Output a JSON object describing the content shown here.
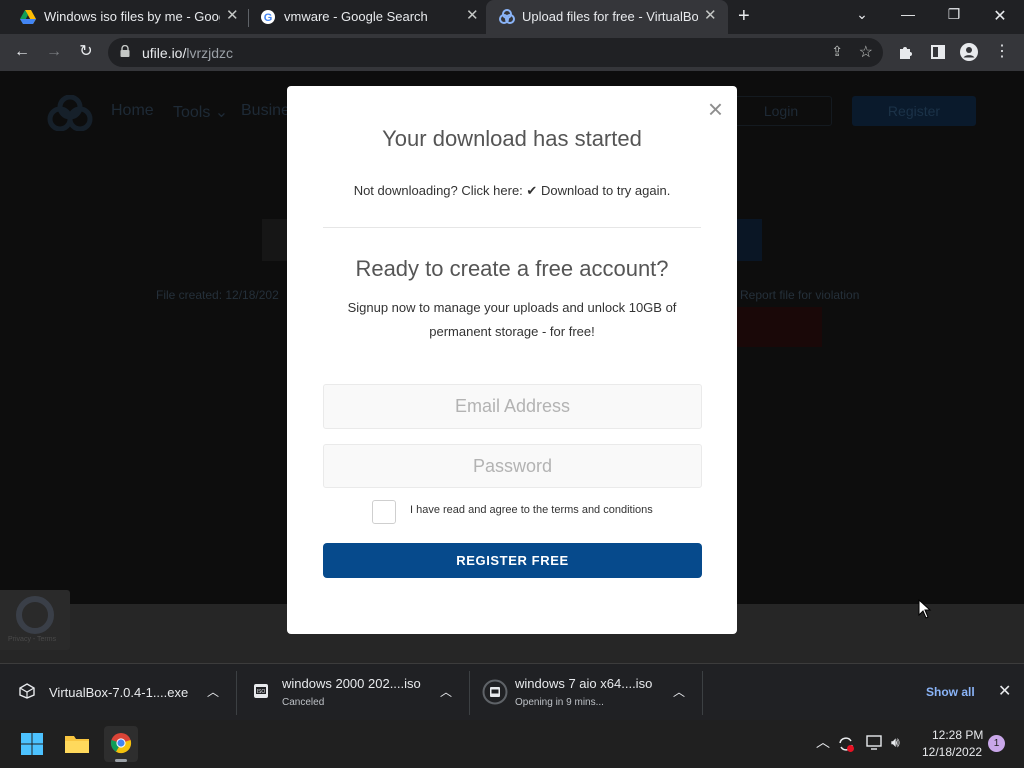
{
  "browser": {
    "tabs": [
      {
        "title": "Windows iso files by me - Google",
        "favicon": "google-drive-icon",
        "active": false
      },
      {
        "title": "vmware - Google Search",
        "favicon": "google-icon",
        "active": false
      },
      {
        "title": "Upload files for free - VirtualBox-",
        "favicon": "ufile-icon",
        "active": true
      }
    ],
    "url_host": "ufile.io/",
    "url_path": "lvrzjdzc"
  },
  "site": {
    "nav": [
      "Home",
      "Tools ⌄",
      "Busine"
    ],
    "login_label": "Login",
    "register_label": "Register",
    "file_created": "File created: 12/18/202",
    "report_link": "Report file for violation"
  },
  "modal": {
    "title": "Your download has started",
    "retry_prefix": "Not downloading? Click here:",
    "retry_link": "Download to try again.",
    "subtitle": "Ready to create a free account?",
    "description": "Signup now to manage your uploads and unlock 10GB of permanent storage - for free!",
    "email_placeholder": "Email Address",
    "password_placeholder": "Password",
    "terms_label": "I have read and agree to the terms and conditions",
    "register_button": "REGISTER FREE",
    "accent_color": "#064a8c"
  },
  "recaptcha": {
    "text": "Privacy - Terms"
  },
  "downloads": {
    "items": [
      {
        "name": "VirtualBox-7.0.4-1....exe",
        "status": "",
        "icon": "virtualbox-file-icon"
      },
      {
        "name": "windows 2000 202....iso",
        "status": "Canceled",
        "icon": "iso-file-icon"
      },
      {
        "name": "windows 7 aio x64....iso",
        "status": "Opening in 9 mins...",
        "icon": "iso-progress-icon"
      }
    ],
    "show_all": "Show all"
  },
  "taskbar": {
    "time": "12:28 PM",
    "date": "12/18/2022",
    "notification_count": "1"
  }
}
